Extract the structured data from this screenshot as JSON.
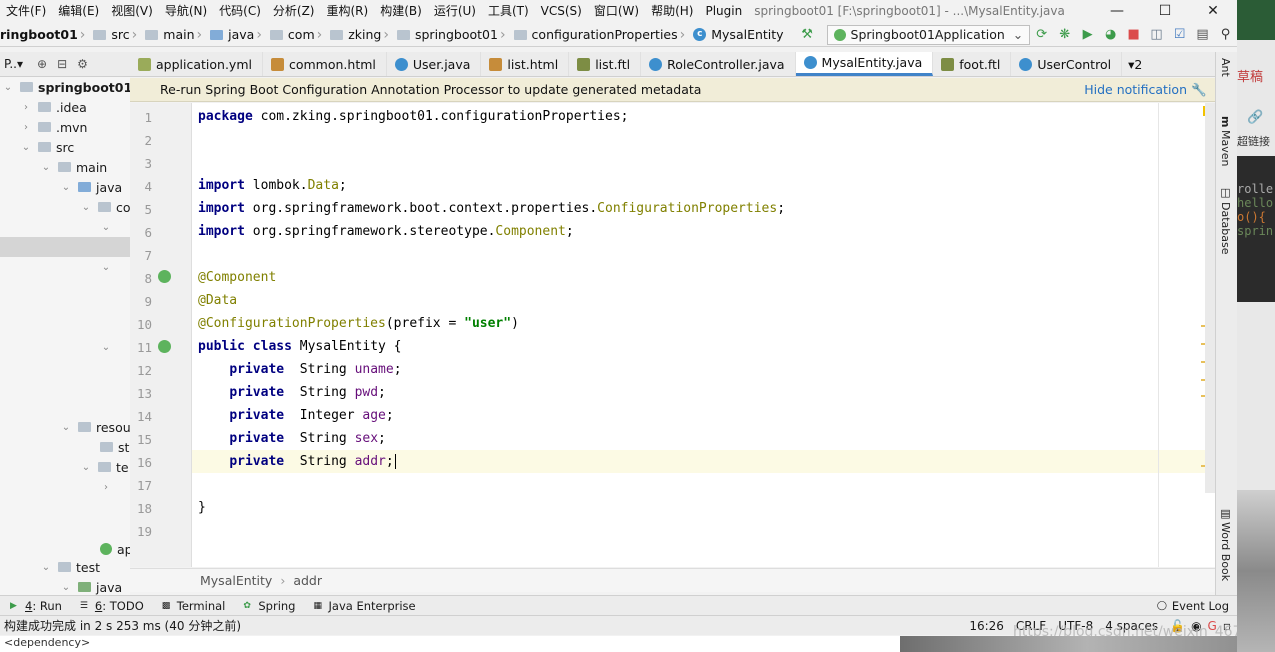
{
  "menu": {
    "items": [
      "文件(F)",
      "编辑(E)",
      "视图(V)",
      "导航(N)",
      "代码(C)",
      "分析(Z)",
      "重构(R)",
      "构建(B)",
      "运行(U)",
      "工具(T)",
      "VCS(S)",
      "窗口(W)",
      "帮助(H)",
      "Plugin"
    ],
    "window_title": "springboot01 [F:\\springboot01] - ...\\MysalEntity.java"
  },
  "nav": {
    "crumbs": [
      "ringboot01",
      "src",
      "main",
      "java",
      "com",
      "zking",
      "springboot01",
      "configurationProperties",
      "MysalEntity"
    ],
    "run_config": "Springboot01Application"
  },
  "project": {
    "header_label": "P..▾",
    "tree": [
      {
        "label": "springboot01",
        "bold": true
      },
      {
        "label": ".idea"
      },
      {
        "label": ".mvn"
      },
      {
        "label": "src"
      },
      {
        "label": "main"
      },
      {
        "label": "java"
      },
      {
        "label": "co"
      },
      {
        "label": "resou"
      },
      {
        "label": "st"
      },
      {
        "label": "te"
      },
      {
        "label": "ap"
      },
      {
        "label": "test"
      },
      {
        "label": "java"
      }
    ]
  },
  "tabs": [
    "application.yml",
    "common.html",
    "User.java",
    "list.html",
    "list.ftl",
    "RoleController.java",
    "MysalEntity.java",
    "foot.ftl",
    "UserControl"
  ],
  "tabs_overflow": "▾2",
  "notification": {
    "message": "Re-run Spring Boot Configuration Annotation Processor to update generated metadata",
    "hide_label": "Hide notification"
  },
  "editor": {
    "line_numbers": [
      "1",
      "2",
      "3",
      "4",
      "5",
      "6",
      "7",
      "8",
      "9",
      "10",
      "11",
      "12",
      "13",
      "14",
      "15",
      "16",
      "17",
      "18",
      "19"
    ],
    "current_line": 16
  },
  "code_breadcrumb": [
    "MysalEntity",
    "addr"
  ],
  "right_strip": [
    "Ant",
    "Maven",
    "Database",
    "Word Book"
  ],
  "bottom_tools": [
    {
      "num": "4",
      "label": "Run"
    },
    {
      "num": "6",
      "label": "TODO"
    },
    {
      "label": "Terminal"
    },
    {
      "label": "Spring"
    },
    {
      "label": "Java Enterprise"
    }
  ],
  "event_log": "Event Log",
  "status": {
    "message": "构建成功完成 in 2 s 253 ms (40 分钟之前)",
    "position": "16:26",
    "line_sep": "CRLF",
    "encoding": "UTF-8",
    "indent": "4 spaces",
    "watermark": "https://blog.csdn.net/weixin_46766150"
  },
  "below_status": "<dependency>",
  "right_window": {
    "label1": "草稿",
    "label2": "超链接",
    "code1": "rolle",
    "code2": "hello",
    "code3": "o(){",
    "code4": "sprin"
  },
  "colors": {
    "accent": "#4083c9",
    "keyword": "#000080",
    "annotation": "#808000",
    "string": "#008000",
    "field": "#660e7a"
  }
}
